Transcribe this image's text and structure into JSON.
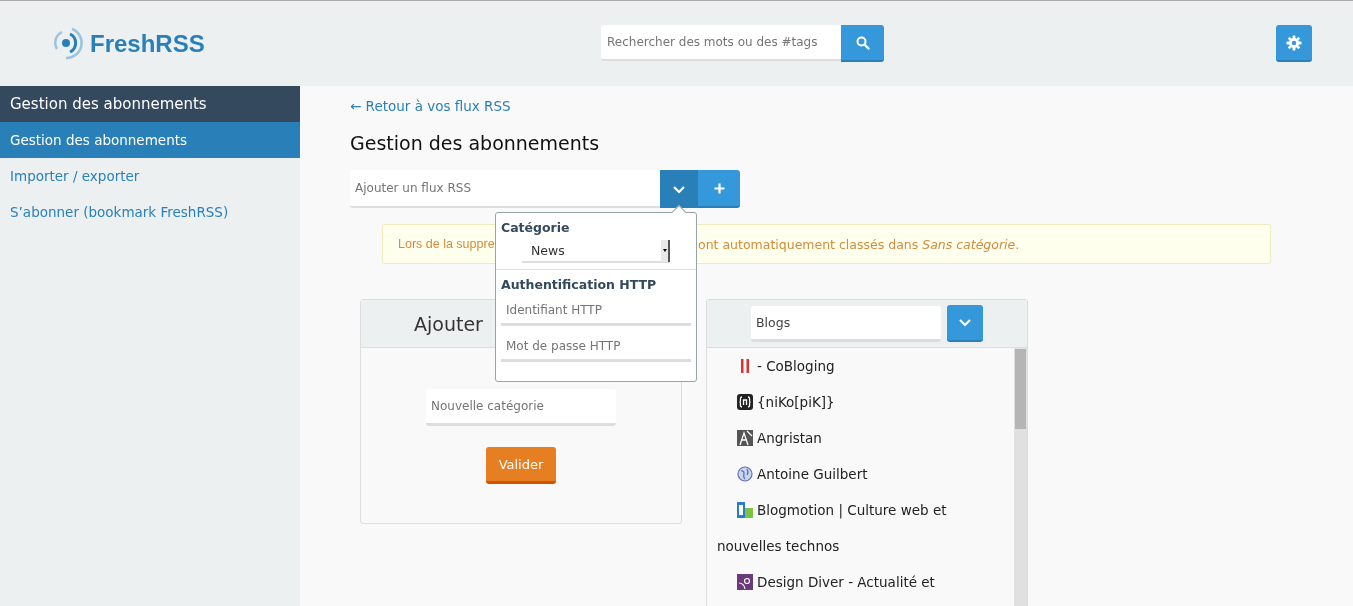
{
  "header": {
    "logo_text": "FreshRSS",
    "search": {
      "placeholder": "Rechercher des mots ou des #tags"
    }
  },
  "sidebar": {
    "heading": "Gestion des abonnements",
    "items": [
      {
        "label": "Gestion des abonnements",
        "selected": true
      },
      {
        "label": "Importer / exporter",
        "selected": false
      },
      {
        "label": "S’abonner (bookmark FreshRSS)",
        "selected": false
      }
    ]
  },
  "main": {
    "back_link": "← Retour à vos flux RSS",
    "title": "Gestion des abonnements",
    "add_feed": {
      "placeholder": "Ajouter un flux RSS"
    },
    "feed_popup": {
      "category_label": "Catégorie",
      "category_value": "News",
      "auth_label": "Authentification HTTP",
      "username_placeholder": "Identifiant HTTP",
      "password_placeholder": "Mot de passe HTTP"
    },
    "notice": {
      "text_start": "Lors de la suppre",
      "text_end": "ont automatiquement classés dans *Sans catégorie*."
    },
    "add_category_panel": {
      "title": "Ajouter",
      "placeholder": "Nouvelle catégorie",
      "button": "Valider"
    },
    "feeds_panel": {
      "category_value": "Blogs",
      "feeds": [
        {
          "name": "- CoBloging",
          "kind": "bars"
        },
        {
          "name": "{niKo[piK]}",
          "kind": "code"
        },
        {
          "name": "Angristan",
          "kind": "letter"
        },
        {
          "name": "Antoine Guilbert",
          "kind": "globe"
        },
        {
          "name": "Blogmotion | Culture web et nouvelles technos",
          "kind": "tiles"
        },
        {
          "name": "Design Diver - Actualité et",
          "kind": "swirl"
        }
      ]
    }
  }
}
